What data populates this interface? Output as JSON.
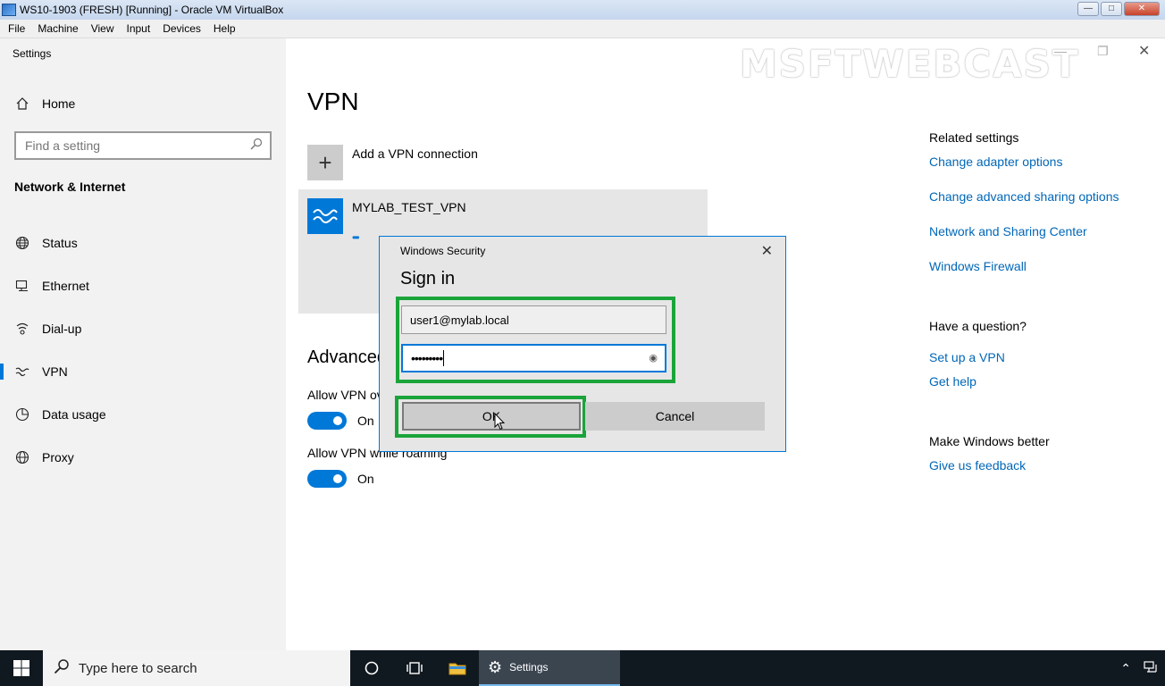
{
  "vbox": {
    "title": "WS10-1903 (FRESH) [Running] - Oracle VM VirtualBox",
    "menu": [
      "File",
      "Machine",
      "View",
      "Input",
      "Devices",
      "Help"
    ]
  },
  "watermark": "MSFTWEBCAST",
  "settings": {
    "window_title": "Settings",
    "home_label": "Home",
    "search_placeholder": "Find a setting",
    "section": "Network & Internet",
    "nav": [
      {
        "label": "Status",
        "icon": "globe-icon"
      },
      {
        "label": "Ethernet",
        "icon": "ethernet-icon"
      },
      {
        "label": "Dial-up",
        "icon": "dialup-icon"
      },
      {
        "label": "VPN",
        "icon": "vpn-icon",
        "active": true
      },
      {
        "label": "Data usage",
        "icon": "data-usage-icon"
      },
      {
        "label": "Proxy",
        "icon": "proxy-globe-icon"
      }
    ]
  },
  "main": {
    "heading": "VPN",
    "add_vpn_label": "Add a VPN connection",
    "vpn_connection_name": "MYLAB_TEST_VPN",
    "advanced_heading": "Advanced",
    "option1_label": "Allow VPN over metered networks",
    "option1_state": "On",
    "option2_label": "Allow VPN while roaming",
    "option2_state": "On"
  },
  "related": {
    "heading": "Related settings",
    "links": [
      "Change adapter options",
      "Change advanced sharing options",
      "Network and Sharing Center",
      "Windows Firewall"
    ],
    "question_heading": "Have a question?",
    "question_links": [
      "Set up a VPN",
      "Get help"
    ],
    "better_heading": "Make Windows better",
    "feedback_link": "Give us feedback"
  },
  "dialog": {
    "title": "Windows Security",
    "heading": "Sign in",
    "username": "user1@mylab.local",
    "password_mask": "•••••••••",
    "ok_label": "OK",
    "cancel_label": "Cancel",
    "highlight_color": "#1aa43a"
  },
  "taskbar": {
    "search_text": "Type here to search",
    "active_app": "Settings"
  }
}
